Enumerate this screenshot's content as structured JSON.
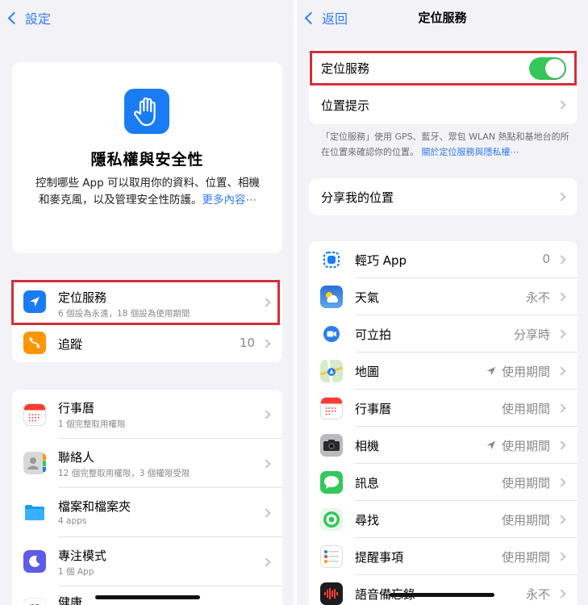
{
  "left": {
    "back_label": "設定",
    "hero": {
      "title": "隱私權與安全性",
      "desc": "控制哪些 App 可以取用你的資料、位置、相機和麥克風，以及管理安全性防護。",
      "more": "更多內容⋯"
    },
    "group1": [
      {
        "title": "定位服務",
        "sub": "6 個設為永遠，18 個設為使用期間",
        "value": "",
        "icon": "location-arrow-icon",
        "color": "#1a7cf5"
      },
      {
        "title": "追蹤",
        "sub": "",
        "value": "10",
        "icon": "tracking-icon",
        "color": "#ff9500"
      }
    ],
    "group2": [
      {
        "title": "行事曆",
        "sub": "1 個完整取用權限",
        "icon": "calendar-icon"
      },
      {
        "title": "聯絡人",
        "sub": "12 個完整取用權限，3 個權限受限",
        "icon": "contacts-icon"
      },
      {
        "title": "檔案和檔案夾",
        "sub": "4 apps",
        "icon": "folder-icon"
      },
      {
        "title": "專注模式",
        "sub": "1 個 App",
        "icon": "moon-icon"
      },
      {
        "title": "健康",
        "sub": "",
        "icon": "heart-icon"
      }
    ]
  },
  "right": {
    "back_label": "返回",
    "title": "定位服務",
    "location_services_label": "定位服務",
    "location_services_on": true,
    "location_alerts_label": "位置提示",
    "note": "「定位服務」使用 GPS、藍牙、眾包 WLAN 熱點和基地台的所在位置來確認你的位置。",
    "note_link": "關於定位服務與隱私權⋯",
    "share_location_label": "分享我的位置",
    "apps": [
      {
        "name": "輕巧 App",
        "value": "0",
        "arrow_icon": false,
        "icon": "app-clip-icon"
      },
      {
        "name": "天氣",
        "value": "永不",
        "arrow_icon": false,
        "icon": "weather-icon"
      },
      {
        "name": "可立拍",
        "value": "分享時",
        "arrow_icon": false,
        "icon": "clips-icon"
      },
      {
        "name": "地圖",
        "value": "使用期間",
        "arrow_icon": true,
        "icon": "maps-icon"
      },
      {
        "name": "行事曆",
        "value": "使用期間",
        "arrow_icon": false,
        "icon": "calendar-icon"
      },
      {
        "name": "相機",
        "value": "使用期間",
        "arrow_icon": true,
        "icon": "camera-icon"
      },
      {
        "name": "訊息",
        "value": "使用期間",
        "arrow_icon": false,
        "icon": "messages-icon"
      },
      {
        "name": "尋找",
        "value": "使用期間",
        "arrow_icon": false,
        "icon": "find-my-icon"
      },
      {
        "name": "提醒事項",
        "value": "使用期間",
        "arrow_icon": false,
        "icon": "reminders-icon"
      },
      {
        "name": "語音備忘錄",
        "value": "永不",
        "arrow_icon": false,
        "icon": "voice-memos-icon"
      }
    ]
  },
  "colors": {
    "accent": "#2f7cf6",
    "toggle_on": "#34c759",
    "highlight": "#d32f3a"
  }
}
